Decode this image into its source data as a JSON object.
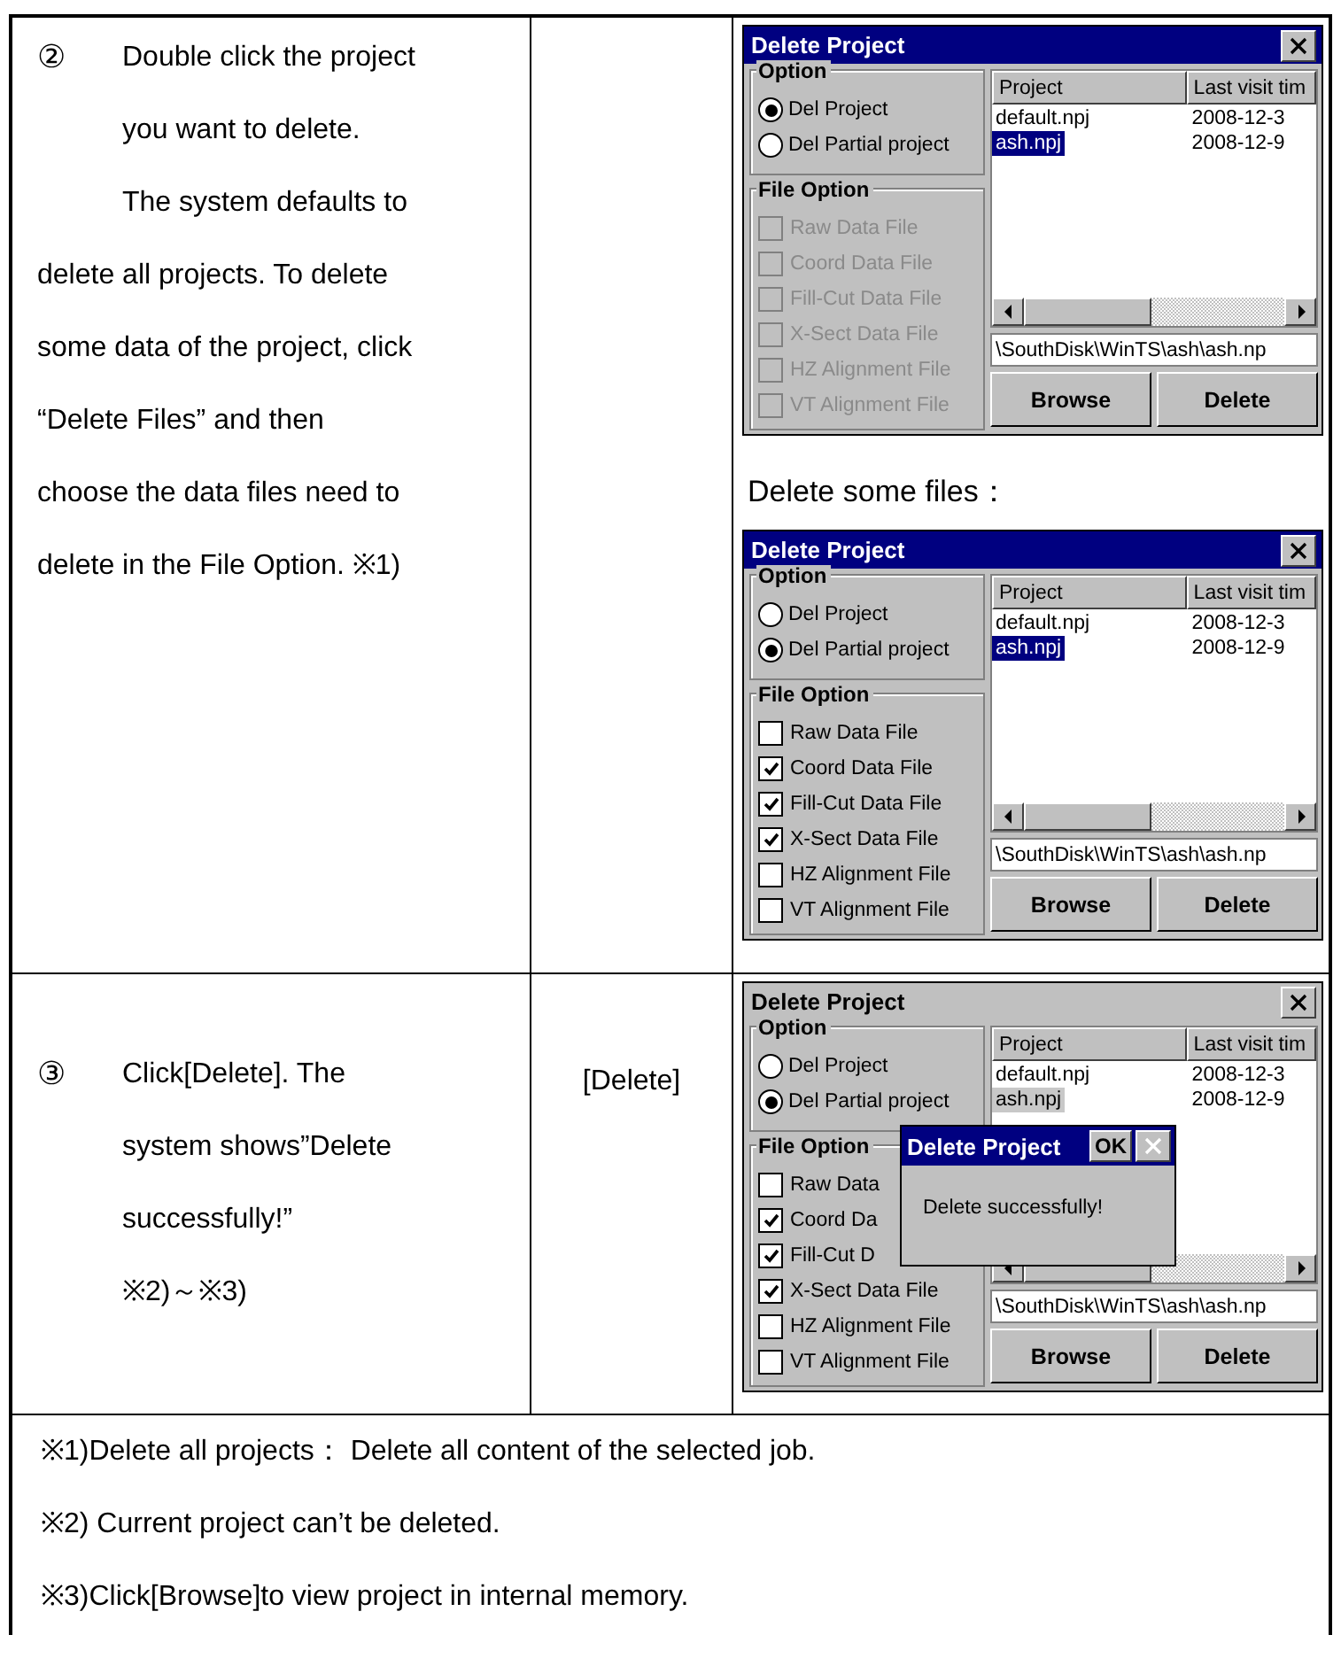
{
  "steps": [
    {
      "number": "②",
      "lines": [
        {
          "text": "Double click the project",
          "indented": true
        },
        {
          "text": "you want to delete.",
          "indented": true
        },
        {
          "text": "The system defaults to",
          "indented": true
        },
        {
          "text": "delete all projects. To delete",
          "indented": false
        },
        {
          "text": "some data of the project, click",
          "indented": false
        },
        {
          "text": "“Delete Files” and then",
          "indented": false
        },
        {
          "text": "choose the data files need to",
          "indented": false
        },
        {
          "text": "delete in the File Option. ※1)",
          "indented": false
        }
      ],
      "panels": [
        {
          "kind": "dialog",
          "title": "Delete Project",
          "active": true,
          "option_group": {
            "label": "Option",
            "options": [
              {
                "label": "Del Project",
                "selected": true
              },
              {
                "label": "Del Partial project",
                "selected": false
              }
            ]
          },
          "file_group": {
            "label": "File Option",
            "disabled": true,
            "items": [
              {
                "label": "Raw Data File",
                "checked": false
              },
              {
                "label": "Coord Data File",
                "checked": false
              },
              {
                "label": "Fill-Cut Data File",
                "checked": false
              },
              {
                "label": "X-Sect Data File",
                "checked": false
              },
              {
                "label": "HZ Alignment File",
                "checked": false
              },
              {
                "label": "VT Alignment File",
                "checked": false
              }
            ]
          },
          "list": {
            "columns": [
              "Project",
              "Last visit tim"
            ],
            "rows": [
              {
                "cells": [
                  "default.npj",
                  "2008-12-3"
                ],
                "selected": false
              },
              {
                "cells": [
                  "ash.npj",
                  "2008-12-9"
                ],
                "selected": true
              }
            ]
          },
          "path": "\\SouthDisk\\WinTS\\ash\\ash.np",
          "buttons": [
            "Browse",
            "Delete"
          ]
        },
        {
          "kind": "caption",
          "text": "Delete some files："
        },
        {
          "kind": "dialog",
          "title": "Delete Project",
          "active": true,
          "option_group": {
            "label": "Option",
            "options": [
              {
                "label": "Del Project",
                "selected": false
              },
              {
                "label": "Del Partial project",
                "selected": true
              }
            ]
          },
          "file_group": {
            "label": "File Option",
            "disabled": false,
            "items": [
              {
                "label": "Raw Data File",
                "checked": false
              },
              {
                "label": "Coord Data File",
                "checked": true
              },
              {
                "label": "Fill-Cut Data File",
                "checked": true
              },
              {
                "label": "X-Sect Data File",
                "checked": true
              },
              {
                "label": "HZ Alignment File",
                "checked": false
              },
              {
                "label": "VT Alignment File",
                "checked": false
              }
            ]
          },
          "list": {
            "columns": [
              "Project",
              "Last visit tim"
            ],
            "rows": [
              {
                "cells": [
                  "default.npj",
                  "2008-12-3"
                ],
                "selected": false
              },
              {
                "cells": [
                  "ash.npj",
                  "2008-12-9"
                ],
                "selected": true
              }
            ]
          },
          "path": "\\SouthDisk\\WinTS\\ash\\ash.np",
          "buttons": [
            "Browse",
            "Delete"
          ]
        }
      ]
    },
    {
      "number": "③",
      "lines": [
        {
          "text": "Click[Delete]. The",
          "indented": true
        },
        {
          "text": "system shows”Delete",
          "indented": true
        },
        {
          "text": "successfully!”",
          "indented": true
        },
        {
          "text": "※2)～※3)",
          "indented": true
        }
      ],
      "action": "[Delete]",
      "panels": [
        {
          "kind": "dialog",
          "title": "Delete Project",
          "active": false,
          "option_group": {
            "label": "Option",
            "options": [
              {
                "label": "Del Project",
                "selected": false
              },
              {
                "label": "Del Partial project",
                "selected": true
              }
            ]
          },
          "file_group": {
            "label": "File Option",
            "disabled": false,
            "items": [
              {
                "label": "Raw Data",
                "checked": false
              },
              {
                "label": "Coord Da",
                "checked": true
              },
              {
                "label": "Fill-Cut D",
                "checked": true
              },
              {
                "label": "X-Sect Data File",
                "checked": true
              },
              {
                "label": "HZ Alignment File",
                "checked": false
              },
              {
                "label": "VT Alignment File",
                "checked": false
              }
            ]
          },
          "list": {
            "columns": [
              "Project",
              "Last visit tim"
            ],
            "rows": [
              {
                "cells": [
                  "default.npj",
                  "2008-12-3"
                ],
                "selected": false
              },
              {
                "cells": [
                  "ash.npj",
                  "2008-12-9"
                ],
                "selected": true
              }
            ]
          },
          "path": "\\SouthDisk\\WinTS\\ash\\ash.np",
          "buttons": [
            "Browse",
            "Delete"
          ],
          "message_box": {
            "title": "Delete Project",
            "ok": "OK",
            "close_disabled": true,
            "message": "Delete successfully!"
          }
        }
      ]
    }
  ],
  "notes": [
    "※1)Delete all projects： Delete all content of the selected job.",
    "※2) Current project can’t be deleted.",
    "※3)Click[Browse]to view project in internal memory."
  ]
}
